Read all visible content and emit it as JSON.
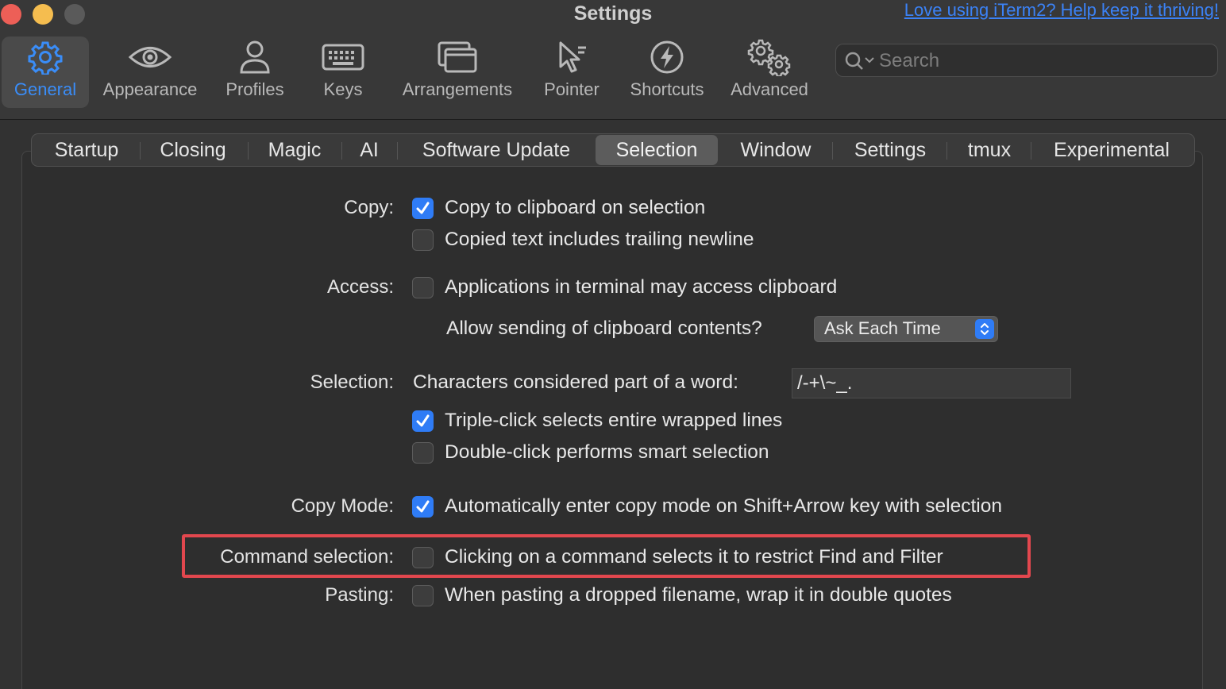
{
  "window": {
    "title": "Settings",
    "donate_link": "Love using iTerm2? Help keep it thriving!"
  },
  "toolbar": {
    "items": [
      {
        "label": "General",
        "icon": "gear-icon",
        "selected": true
      },
      {
        "label": "Appearance",
        "icon": "eye-icon"
      },
      {
        "label": "Profiles",
        "icon": "person-icon"
      },
      {
        "label": "Keys",
        "icon": "keyboard-icon"
      },
      {
        "label": "Arrangements",
        "icon": "windows-icon"
      },
      {
        "label": "Pointer",
        "icon": "pointer-icon"
      },
      {
        "label": "Shortcuts",
        "icon": "bolt-icon"
      },
      {
        "label": "Advanced",
        "icon": "gears-icon"
      }
    ],
    "search_placeholder": "Search"
  },
  "tabs": {
    "items": [
      "Startup",
      "Closing",
      "Magic",
      "AI",
      "Software Update",
      "Selection",
      "Window",
      "Settings",
      "tmux",
      "Experimental"
    ],
    "active": "Selection"
  },
  "copy": {
    "label": "Copy:",
    "option1": "Copy to clipboard on selection",
    "option1_checked": true,
    "option2": "Copied text includes trailing newline",
    "option2_checked": false
  },
  "access": {
    "label": "Access:",
    "option": "Applications in terminal may access clipboard",
    "option_checked": false,
    "allow_label": "Allow sending of clipboard contents?",
    "allow_value": "Ask Each Time"
  },
  "selection": {
    "label": "Selection:",
    "word_chars_label": "Characters considered part of a word:",
    "word_chars_value": "/-+\\~_.",
    "triple_click": "Triple-click selects entire wrapped lines",
    "triple_click_checked": true,
    "double_click": "Double-click performs smart selection",
    "double_click_checked": false
  },
  "copy_mode": {
    "label": "Copy Mode:",
    "option": "Automatically enter copy mode on Shift+Arrow key with selection",
    "option_checked": true
  },
  "command_selection": {
    "label": "Command selection:",
    "option": "Clicking on a command selects it to restrict Find and Filter",
    "option_checked": false,
    "highlight_color": "#e2474e"
  },
  "pasting": {
    "label": "Pasting:",
    "option": "When pasting a dropped filename, wrap it in double quotes",
    "option_checked": false
  },
  "colors": {
    "accent": "#2f7cf6",
    "background": "#323232"
  }
}
